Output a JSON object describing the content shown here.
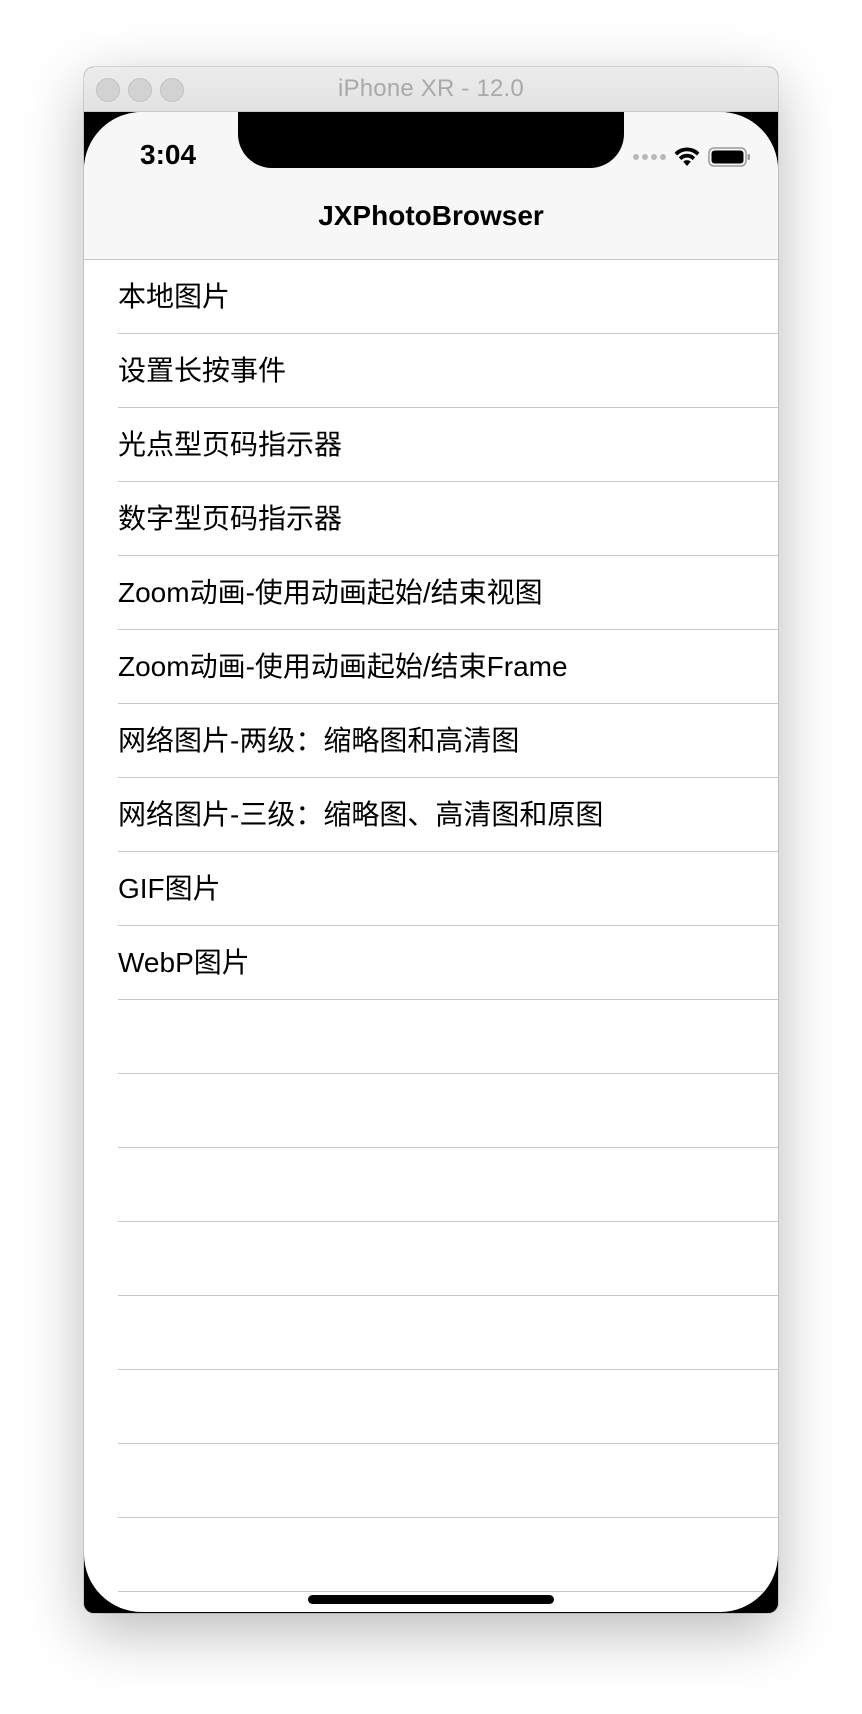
{
  "window": {
    "title": "iPhone XR - 12.0"
  },
  "status_bar": {
    "time": "3:04",
    "icons": [
      "cellular-dots-icon",
      "wifi-icon",
      "battery-icon"
    ]
  },
  "nav_bar": {
    "title": "JXPhotoBrowser"
  },
  "table": {
    "rows": [
      "本地图片",
      "设置长按事件",
      "光点型页码指示器",
      "数字型页码指示器",
      "Zoom动画-使用动画起始/结束视图",
      "Zoom动画-使用动画起始/结束Frame",
      "网络图片-两级：缩略图和高清图",
      "网络图片-三级：缩略图、高清图和原图",
      "GIF图片",
      "WebP图片",
      "",
      "",
      "",
      "",
      "",
      "",
      "",
      "",
      ""
    ]
  },
  "colors": {
    "nav_background": "#f7f7f7",
    "separator": "#c8c7cc",
    "text": "#000000"
  }
}
